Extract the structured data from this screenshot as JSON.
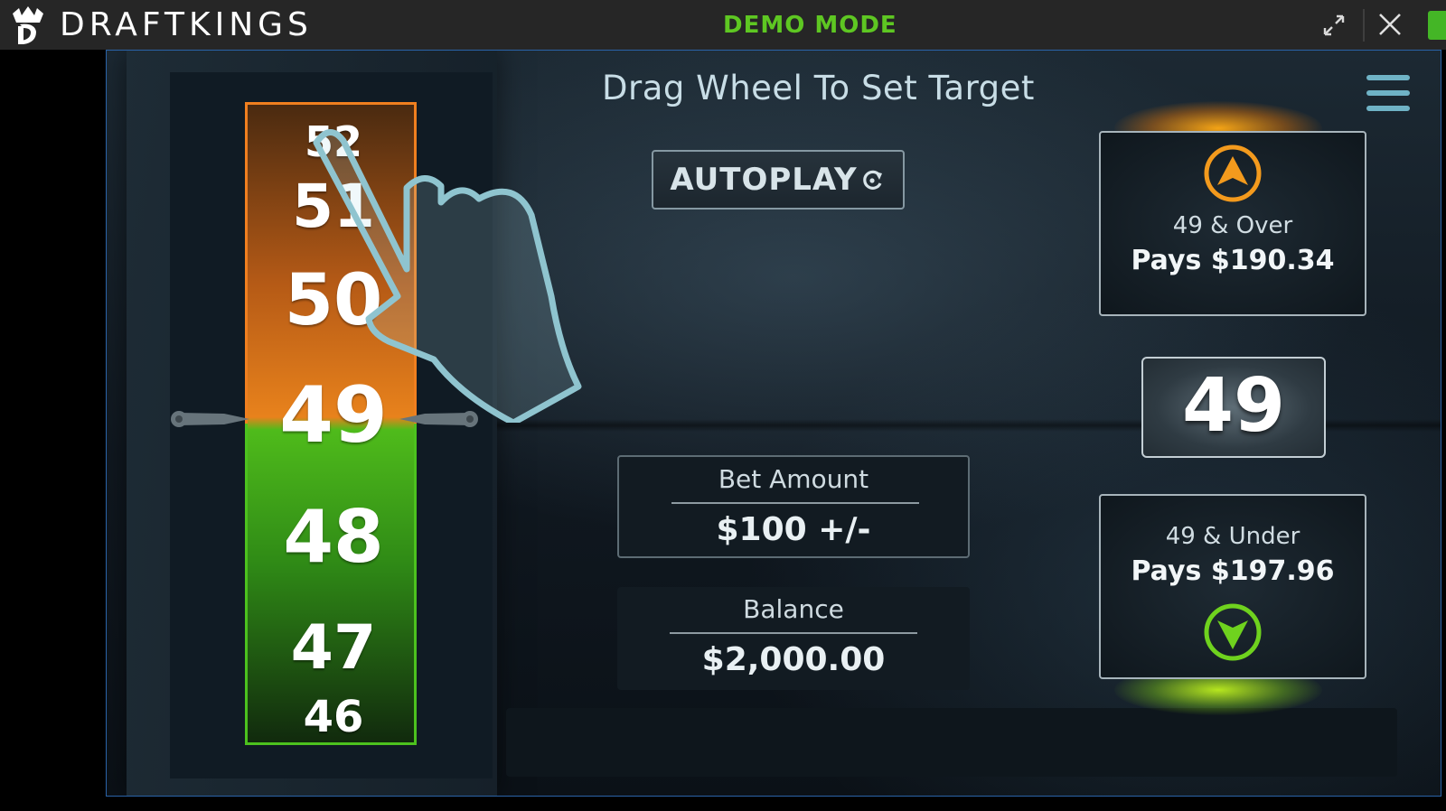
{
  "topbar": {
    "brand": "DRAFTKINGS",
    "mode": "DEMO MODE",
    "icons": [
      "draftkings-crown-logo",
      "expand-icon",
      "close-icon"
    ]
  },
  "game": {
    "title": "Drag Wheel To Set Target",
    "autoplay_label": "AUTOPLAY",
    "wheel_numbers": [
      "52",
      "51",
      "50",
      "49",
      "48",
      "47",
      "46"
    ],
    "selected": "49",
    "over": {
      "range": "49 & Over",
      "pays": "Pays $190.34"
    },
    "under": {
      "range": "49 & Under",
      "pays": "Pays $197.96"
    },
    "bet": {
      "label": "Bet Amount",
      "value": "$100 +/-"
    },
    "balance": {
      "label": "Balance",
      "value": "$2,000.00"
    },
    "target": "49"
  },
  "colors": {
    "demo_green": "#5ec722",
    "over_orange": "#f07f1f",
    "under_green": "#58c320",
    "frame_blue": "#2a63a8"
  }
}
